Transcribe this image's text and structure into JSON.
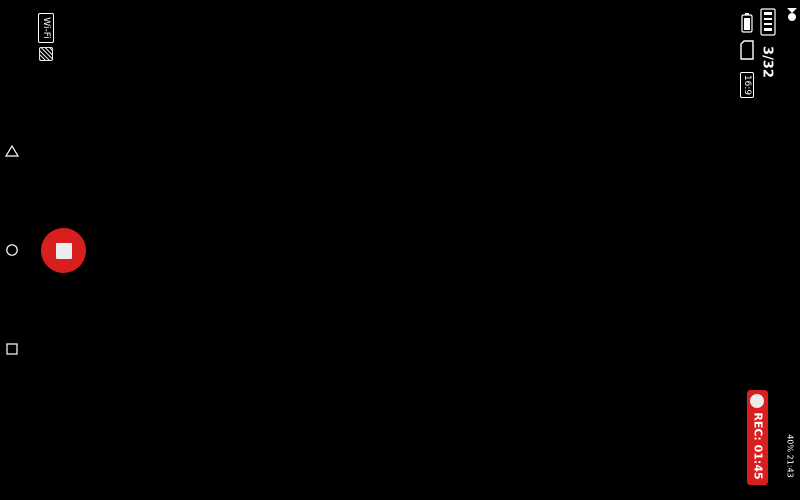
{
  "top_left": {
    "wifi_label": "Wi-Fi"
  },
  "nav": {
    "back_icon": "triangle-back-icon",
    "home_icon": "circle-home-icon",
    "recents_icon": "square-recents-icon"
  },
  "controls": {
    "stop_icon": "stop-square-icon",
    "accent_color": "#d81f1f"
  },
  "top_right": {
    "photo_count": "3/32",
    "ratio_label": "16:9",
    "hd_icon": "hd-icon",
    "battery_icon": "battery-icon",
    "sd_icon": "sd-card-icon"
  },
  "recording": {
    "label": "REC: 01:45"
  },
  "system_status": {
    "text": "40% 21:43"
  }
}
